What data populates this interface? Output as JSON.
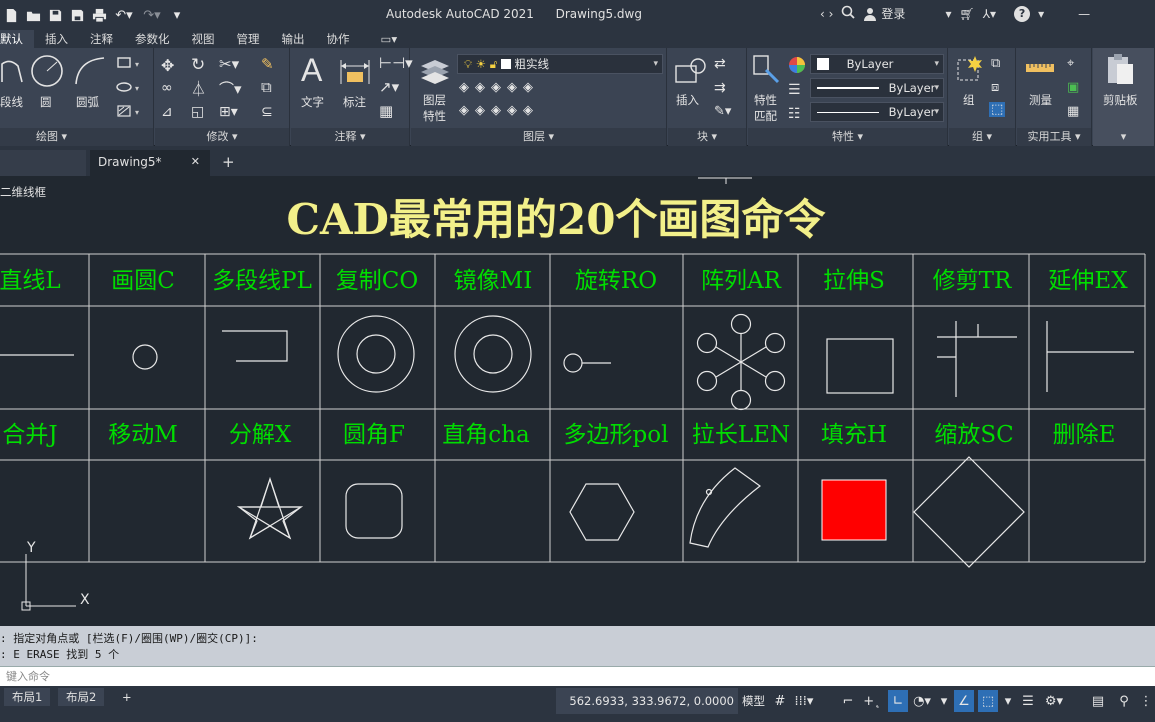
{
  "window": {
    "app_title": "Autodesk AutoCAD 2021",
    "file_name": "Drawing5.dwg",
    "login_label": "登录"
  },
  "ribbon_tabs": [
    "默认",
    "插入",
    "注释",
    "参数化",
    "视图",
    "管理",
    "输出",
    "协作"
  ],
  "ribbon": {
    "draw": {
      "title": "绘图 ▾",
      "polyline": "段线",
      "circle": "圆",
      "arc": "圆弧"
    },
    "modify": {
      "title": "修改 ▾"
    },
    "annotation": {
      "title": "注释 ▾",
      "text": "文字",
      "dimension": "标注"
    },
    "layers": {
      "title": "图层 ▾",
      "layer_props_1": "图层",
      "layer_props_2": "特性",
      "current_layer": "粗实线"
    },
    "block": {
      "title": "块 ▾",
      "insert": "插入"
    },
    "properties": {
      "title": "特性 ▾",
      "match_1": "特性",
      "match_2": "匹配",
      "color": "ByLayer",
      "linetype": "ByLayer",
      "lineweight": "ByLayer"
    },
    "group": {
      "title": "组 ▾",
      "group": "组"
    },
    "utilities": {
      "title": "实用工具 ▾",
      "measure": "测量"
    },
    "clipboard": {
      "title": "▾",
      "paste": "剪贴板"
    }
  },
  "doc_tabs": {
    "active": "Drawing5*",
    "close": "✕",
    "add": "+"
  },
  "canvas": {
    "view_label": "二维线框",
    "heading": "CAD最常用的20个画图命令",
    "row1": [
      "直线L",
      "画圆C",
      "多段线PL",
      "复制CO",
      "镜像MI",
      "旋转RO",
      "阵列AR",
      "拉伸S",
      "修剪TR",
      "延伸EX"
    ],
    "row2": [
      "合并J",
      "移动M",
      "分解X",
      "圆角F",
      "直角cha",
      "多边形pol",
      "拉长LEN",
      "填充H",
      "缩放SC",
      "删除E"
    ],
    "axis_y": "Y",
    "axis_x": "X",
    "hatch_color": "#ff0000",
    "label_color": "#00dd00",
    "heading_color": "#f2f08a"
  },
  "command": {
    "history": [
      ": 指定对角点或 [栏选(F)/圈围(WP)/圈交(CP)]:",
      ": E ERASE 找到 5 个"
    ],
    "input_placeholder": "键入命令"
  },
  "status": {
    "layout1": "布局1",
    "layout2": "布局2",
    "add": "+",
    "coordinates": "562.6933, 333.9672, 0.0000",
    "model": "模型"
  }
}
